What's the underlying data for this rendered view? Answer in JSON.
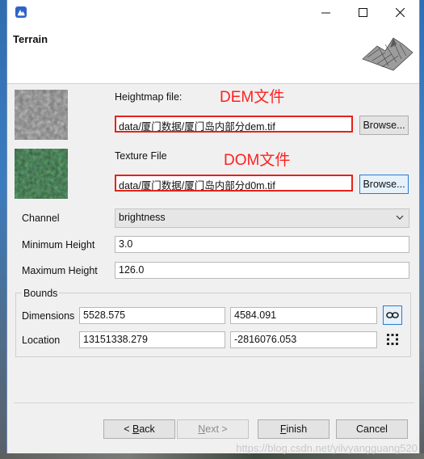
{
  "header": {
    "title": "Terrain"
  },
  "heightmap": {
    "label": "Heightmap file:",
    "annotation": "DEM文件",
    "path": "data/厦门数据/厦门岛内部分dem.tif",
    "browse_label": "Browse..."
  },
  "texture": {
    "label": "Texture File",
    "annotation": "DOM文件",
    "path": "data/厦门数据/厦门岛内部分d0m.tif",
    "browse_label": "Browse..."
  },
  "channel": {
    "label": "Channel",
    "value": "brightness"
  },
  "min_height": {
    "label": "Minimum Height",
    "value": "3.0"
  },
  "max_height": {
    "label": "Maximum Height",
    "value": "126.0"
  },
  "bounds": {
    "title": "Bounds",
    "dimensions": {
      "label": "Dimensions",
      "x": "5528.575",
      "y": "4584.091"
    },
    "location": {
      "label": "Location",
      "x": "13151338.279",
      "y": "-2816076.053"
    }
  },
  "buttons": {
    "back_prefix": "< ",
    "back_key": "B",
    "back_rest": "ack",
    "next_key": "N",
    "next_rest": "ext >",
    "finish_key": "F",
    "finish_rest": "inish",
    "cancel": "Cancel"
  },
  "watermark": "https://blog.csdn.net/yilvyangguang520",
  "colors": {
    "annotation": "#ff2020",
    "highlight_border": "#e2231a",
    "focus_border": "#2a7ad2"
  },
  "icons": [
    "app-icon",
    "minimize-icon",
    "maximize-icon",
    "close-icon",
    "terrain-preview-icon",
    "link-icon",
    "grid-icon",
    "chevron-down-icon"
  ]
}
